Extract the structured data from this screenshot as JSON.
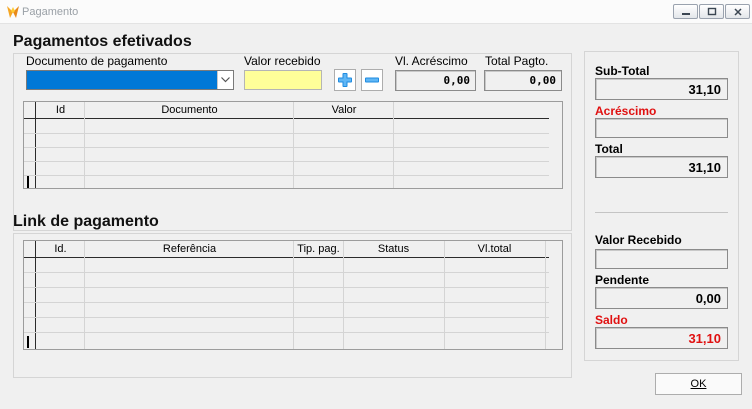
{
  "window": {
    "title": "Pagamento"
  },
  "pagamentos": {
    "title": "Pagamentos efetivados",
    "documento_label": "Documento de pagamento",
    "valor_recebido_label": "Valor recebido",
    "acrescimo_label": "Vl. Acréscimo",
    "acrescimo_value": "0,00",
    "total_pagto_label": "Total Pagto.",
    "total_pagto_value": "0,00",
    "columns": [
      "Id",
      "Documento",
      "Valor"
    ]
  },
  "link": {
    "title": "Link de pagamento",
    "columns": [
      "Id.",
      "Referência",
      "Tip. pag.",
      "Status",
      "Vl.total"
    ]
  },
  "summary": {
    "subtotal_label": "Sub-Total",
    "subtotal_value": "31,10",
    "acrescimo_label": "Acréscimo",
    "acrescimo_value": "",
    "total_label": "Total",
    "total_value": "31,10",
    "valor_recebido_label": "Valor Recebido",
    "valor_recebido_value": "",
    "pendente_label": "Pendente",
    "pendente_value": "0,00",
    "saldo_label": "Saldo",
    "saldo_value": "31,10"
  },
  "actions": {
    "ok_label": "OK"
  },
  "colors": {
    "accent_blue": "#0078d7",
    "highlight_yellow": "#ffff99",
    "alert_red": "#e01010"
  },
  "icons": {
    "app": "app-logo-icon",
    "add": "plus-icon",
    "remove": "minus-icon",
    "dropdown": "chevron-down-icon"
  }
}
